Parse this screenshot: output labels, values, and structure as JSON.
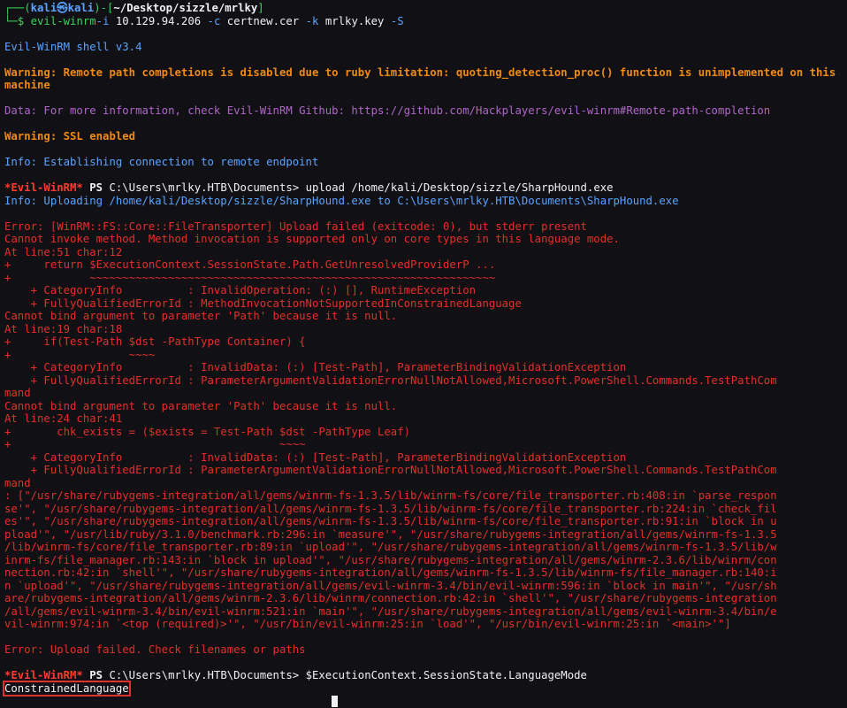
{
  "prompt": {
    "top": "┌──(",
    "user": "kali",
    "at": "㉿",
    "host": "kali",
    "mid": ")-[",
    "path": "~/Desktop/sizzle/mrlky",
    "end": "]",
    "bottom": "└─$ ",
    "command": "evil-winrm",
    "args": [
      {
        "flag": "-i",
        "value": " 10.129.94.206 "
      },
      {
        "flag": "-c",
        "value": " certnew.cer "
      },
      {
        "flag": "-k",
        "value": " mrlky.key "
      },
      {
        "flag": "-S",
        "value": ""
      }
    ]
  },
  "banner": "Evil-WinRM shell v3.4",
  "warning_remote": "Warning: Remote path completions is disabled due to ruby limitation: quoting_detection_proc() function is unimplemented on this machine",
  "data_info": "Data: For more information, check Evil-WinRM Github: https://github.com/Hackplayers/evil-winrm#Remote-path-completion",
  "warning_ssl": "Warning: SSL enabled",
  "info_connect": "Info: Establishing connection to remote endpoint",
  "ps1": {
    "tag": "*Evil-WinRM*",
    "ps": " PS ",
    "path": "C:\\Users\\mrlky.HTB\\Documents>",
    "command": " upload /home/kali/Desktop/sizzle/SharpHound.exe"
  },
  "info_upload": "Info: Uploading /home/kali/Desktop/sizzle/SharpHound.exe to C:\\Users\\mrlky.HTB\\Documents\\SharpHound.exe",
  "error_lines": [
    "Error: [WinRM::FS::Core::FileTransporter] Upload failed (exitcode: 0), but stderr present",
    "Cannot invoke method. Method invocation is supported only on core types in this language mode.",
    "At line:51 char:12",
    "+     return $ExecutionContext.SessionState.Path.GetUnresolvedProviderP ...",
    "+            ~~~~~~~~~~~~~~~~~~~~~~~~~~~~~~~~~~~~~~~~~~~~~~~~~~~~~~~~~~~~~~",
    "    + CategoryInfo          : InvalidOperation: (:) [], RuntimeException",
    "    + FullyQualifiedErrorId : MethodInvocationNotSupportedInConstrainedLanguage",
    "Cannot bind argument to parameter 'Path' because it is null.",
    "At line:19 char:18",
    "+     if(Test-Path $dst -PathType Container) {",
    "+                  ~~~~",
    "    + CategoryInfo          : InvalidData: (:) [Test-Path], ParameterBindingValidationException",
    "    + FullyQualifiedErrorId : ParameterArgumentValidationErrorNullNotAllowed,Microsoft.PowerShell.Commands.TestPathCom",
    "mand",
    "Cannot bind argument to parameter 'Path' because it is null.",
    "At line:24 char:41",
    "+       chk_exists = ($exists = Test-Path $dst -PathType Leaf)",
    "+                                         ~~~~",
    "    + CategoryInfo          : InvalidData: (:) [Test-Path], ParameterBindingValidationException",
    "    + FullyQualifiedErrorId : ParameterArgumentValidationErrorNullNotAllowed,Microsoft.PowerShell.Commands.TestPathCom",
    "mand",
    ": [\"/usr/share/rubygems-integration/all/gems/winrm-fs-1.3.5/lib/winrm-fs/core/file_transporter.rb:408:in `parse_respon",
    "se'\", \"/usr/share/rubygems-integration/all/gems/winrm-fs-1.3.5/lib/winrm-fs/core/file_transporter.rb:224:in `check_fil",
    "es'\", \"/usr/share/rubygems-integration/all/gems/winrm-fs-1.3.5/lib/winrm-fs/core/file_transporter.rb:91:in `block in u",
    "pload'\", \"/usr/lib/ruby/3.1.0/benchmark.rb:296:in `measure'\", \"/usr/share/rubygems-integration/all/gems/winrm-fs-1.3.5",
    "/lib/winrm-fs/core/file_transporter.rb:89:in `upload'\", \"/usr/share/rubygems-integration/all/gems/winrm-fs-1.3.5/lib/w",
    "inrm-fs/file_manager.rb:143:in `block in upload'\", \"/usr/share/rubygems-integration/all/gems/winrm-2.3.6/lib/winrm/con",
    "nection.rb:42:in `shell'\", \"/usr/share/rubygems-integration/all/gems/winrm-fs-1.3.5/lib/winrm-fs/file_manager.rb:140:i",
    "n `upload'\", \"/usr/share/rubygems-integration/all/gems/evil-winrm-3.4/bin/evil-winrm:596:in `block in main'\", \"/usr/sh",
    "are/rubygems-integration/all/gems/winrm-2.3.6/lib/winrm/connection.rb:42:in `shell'\", \"/usr/share/rubygems-integration",
    "/all/gems/evil-winrm-3.4/bin/evil-winrm:521:in `main'\", \"/usr/share/rubygems-integration/all/gems/evil-winrm-3.4/bin/e",
    "vil-winrm:974:in `<top (required)>'\", \"/usr/bin/evil-winrm:25:in `load'\", \"/usr/bin/evil-winrm:25:in `<main>'\"]"
  ],
  "error_upload": "Error: Upload failed. Check filenames or paths",
  "ps2": {
    "tag": "*Evil-WinRM*",
    "ps": " PS ",
    "path": "C:\\Users\\mrlky.HTB\\Documents>",
    "command": " $ExecutionContext.SessionState.LanguageMode"
  },
  "result": "ConstrainedLanguage"
}
